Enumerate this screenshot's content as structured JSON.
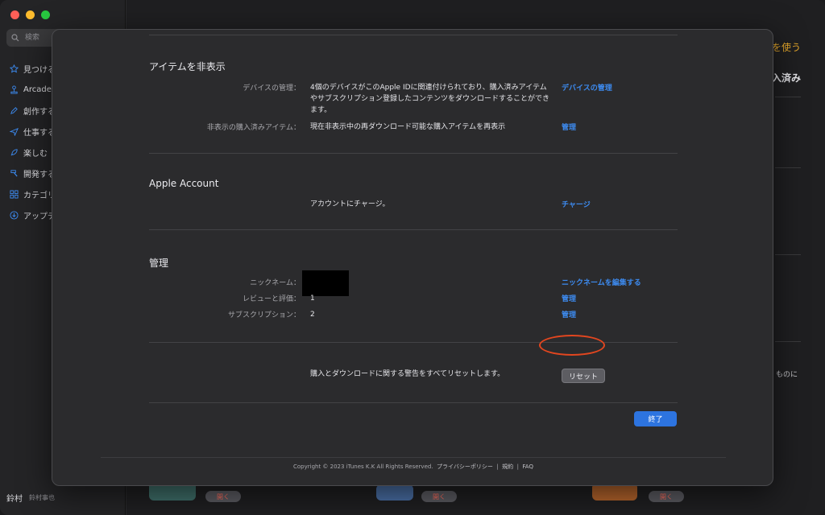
{
  "sidebar": {
    "search_placeholder": "検索",
    "items": [
      {
        "label": "見つける",
        "icon": "star-icon"
      },
      {
        "label": "Arcade",
        "icon": "joystick-icon"
      },
      {
        "label": "創作する",
        "icon": "pencil-icon"
      },
      {
        "label": "仕事する",
        "icon": "paperplane-icon"
      },
      {
        "label": "楽しむ",
        "icon": "rocket-icon"
      },
      {
        "label": "開発する",
        "icon": "hammer-icon"
      },
      {
        "label": "カテゴリ",
        "icon": "grid-icon"
      },
      {
        "label": "アップデート",
        "icon": "download-icon"
      }
    ],
    "user_name": "鈴村",
    "user_sub": "鈴村事也"
  },
  "background": {
    "right_link": "を使う",
    "right_heading": "入済み",
    "right_text": "ものに",
    "get_label": "開く"
  },
  "sheet": {
    "hidden_items": {
      "title": "アイテムを非表示",
      "rows": [
        {
          "label": "デバイスの管理：",
          "value": "4個のデバイスがこのApple IDに関連付けられており、購入済みアイテムやサブスクリプション登録したコンテンツをダウンロードすることができます。",
          "action": "デバイスの管理"
        },
        {
          "label": "非表示の購入済みアイテム：",
          "value": "現在非表示中の再ダウンロード可能な購入アイテムを再表示",
          "action": "管理"
        }
      ]
    },
    "apple_account": {
      "title": "Apple Account",
      "rows": [
        {
          "label": "",
          "value": "アカウントにチャージ。",
          "action": "チャージ"
        }
      ]
    },
    "manage": {
      "title": "管理",
      "rows": [
        {
          "label": "ニックネーム：",
          "value": "",
          "action": "ニックネームを編集する"
        },
        {
          "label": "レビューと評価：",
          "value": "1",
          "action": "管理"
        },
        {
          "label": "サブスクリプション：",
          "value": "2",
          "action": "管理"
        }
      ]
    },
    "reset": {
      "value": "購入とダウンロードに関する警告をすべてリセットします。",
      "button": "リセット"
    },
    "done_button": "終了",
    "footer": {
      "copyright": "Copyright © 2023 iTunes K.K All Rights Reserved.",
      "privacy": "プライバシーポリシー",
      "terms": "規約",
      "faq": "FAQ",
      "sep": "|"
    }
  },
  "colors": {
    "link": "#3d8bf0",
    "primary_button": "#2d74e0",
    "annotation": "#e2461f"
  }
}
